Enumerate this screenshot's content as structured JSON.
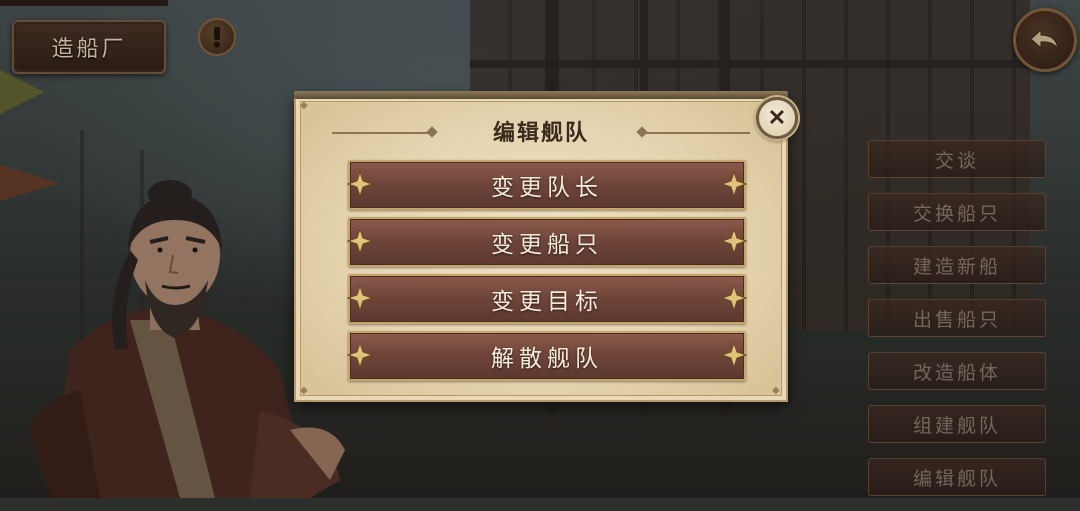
{
  "top_bar": {
    "title": "造船厂",
    "alert_icon": "exclamation-icon",
    "back_icon": "back-arrow-icon"
  },
  "side_menu": {
    "items": [
      {
        "label": "交谈"
      },
      {
        "label": "交换船只"
      },
      {
        "label": "建造新船"
      },
      {
        "label": "出售船只"
      },
      {
        "label": "改造船体"
      },
      {
        "label": "组建舰队"
      },
      {
        "label": "编辑舰队"
      }
    ]
  },
  "dialog": {
    "title": "编辑舰队",
    "close_icon": "close-icon",
    "options": [
      {
        "label": "变更队长"
      },
      {
        "label": "变更船只"
      },
      {
        "label": "变更目标"
      },
      {
        "label": "解散舰队"
      }
    ]
  },
  "colors": {
    "dialog_bg": "#e6d5b2",
    "button_fill": "#6e4438",
    "button_border": "#c6a46a",
    "button_text": "#f6ecdc",
    "title_text": "#3b2a1d"
  }
}
